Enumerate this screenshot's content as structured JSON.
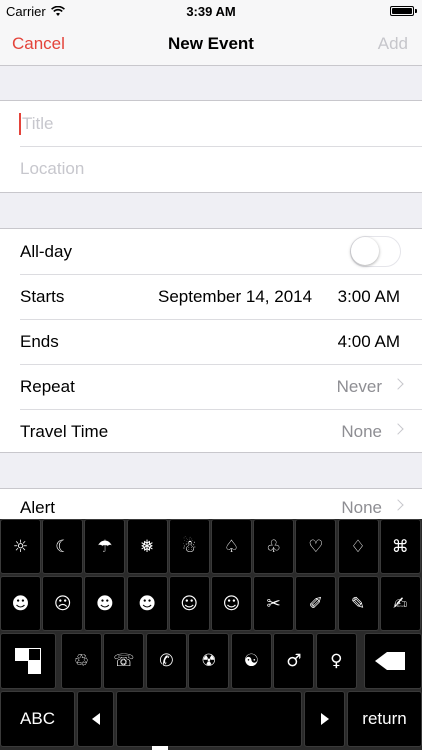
{
  "status_bar": {
    "carrier": "Carrier",
    "time": "3:39 AM"
  },
  "nav": {
    "cancel": "Cancel",
    "title": "New Event",
    "add": "Add"
  },
  "form": {
    "title_placeholder": "Title",
    "location_placeholder": "Location",
    "all_day": {
      "label": "All-day",
      "on": false
    },
    "starts": {
      "label": "Starts",
      "date": "September 14, 2014",
      "time": "3:00 AM"
    },
    "ends": {
      "label": "Ends",
      "time": "4:00 AM"
    },
    "repeat": {
      "label": "Repeat",
      "value": "Never"
    },
    "travel_time": {
      "label": "Travel Time",
      "value": "None"
    },
    "alert": {
      "label": "Alert",
      "value": "None"
    }
  },
  "keyboard": {
    "row1": [
      "☼",
      "☾",
      "☂",
      "❅",
      "☃",
      "♤",
      "♧",
      "♡",
      "♢",
      "⌘"
    ],
    "row1_icons": [
      "sun-icon",
      "moon-icon",
      "umbrella-icon",
      "snowflake-icon",
      "snowman-icon",
      "spade-icon",
      "club-icon",
      "heart-icon",
      "diamond-icon",
      "command-icon"
    ],
    "row2": [
      "☻",
      "☹",
      "☻",
      "☻",
      "☺",
      "☺",
      "✂",
      "✐",
      "✎",
      "✍"
    ],
    "row2_icons": [
      "smiley-filled-icon",
      "frown-icon",
      "face-icon",
      "face-icon",
      "smiley-icon",
      "smiley-icon",
      "scissors-icon",
      "pencil-icon",
      "pencil-icon",
      "writing-hand-icon"
    ],
    "row3": [
      "♲",
      "☏",
      "✆",
      "☢",
      "☯",
      "♂",
      "♀"
    ],
    "row3_icons": [
      "recycle-icon",
      "telephone-icon",
      "phone-icon",
      "radioactive-icon",
      "yin-yang-icon",
      "male-icon",
      "female-icon"
    ],
    "abc_label": "ABC",
    "return_label": "return",
    "colors": {
      "key_bg": "#000000",
      "board_bg": "#2a2a2a",
      "accent": "#e4433a"
    }
  }
}
